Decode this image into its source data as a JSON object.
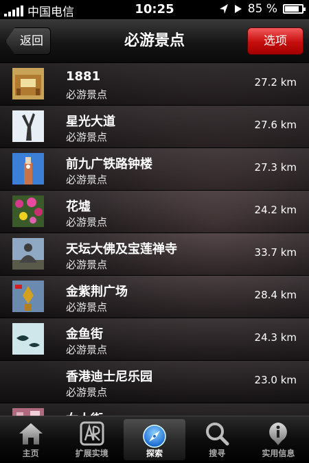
{
  "status": {
    "carrier": "中国电信",
    "time": "10:25",
    "battery": "85 %",
    "battery_level": 0.85
  },
  "nav": {
    "back_label": "返回",
    "title": "必游景点",
    "options_label": "选项"
  },
  "places": [
    {
      "name": "1881",
      "category": "必游景点",
      "distance": "27.2 km"
    },
    {
      "name": "星光大道",
      "category": "必游景点",
      "distance": "27.6 km"
    },
    {
      "name": "前九广铁路钟楼",
      "category": "必游景点",
      "distance": "27.3 km"
    },
    {
      "name": "花墟",
      "category": "必游景点",
      "distance": "24.2 km"
    },
    {
      "name": "天坛大佛及宝莲禅寺",
      "category": "必游景点",
      "distance": "33.7 km"
    },
    {
      "name": "金紫荆广场",
      "category": "必游景点",
      "distance": "28.4 km"
    },
    {
      "name": "金鱼街",
      "category": "必游景点",
      "distance": "24.3 km"
    },
    {
      "name": "香港迪士尼乐园",
      "category": "必游景点",
      "distance": "23.0 km"
    },
    {
      "name": "女人街",
      "category": "",
      "distance": ""
    }
  ],
  "tabs": [
    {
      "label": "主页",
      "icon": "home-icon"
    },
    {
      "label": "扩展实境",
      "icon": "ar-icon"
    },
    {
      "label": "探索",
      "icon": "compass-icon"
    },
    {
      "label": "搜寻",
      "icon": "search-icon"
    },
    {
      "label": "实用信息",
      "icon": "info-icon"
    }
  ],
  "colors": {
    "accent_red": "#d01010",
    "nav_dark": "#151515"
  }
}
